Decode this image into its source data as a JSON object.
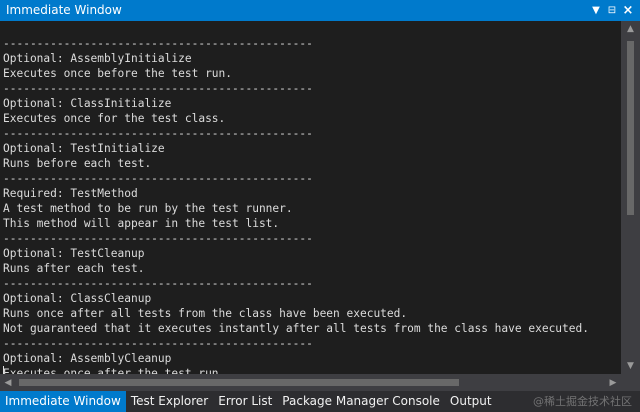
{
  "window": {
    "title": "Immediate Window",
    "dropdown_glyph": "▼",
    "pin_glyph": "⊟",
    "close_glyph": "×"
  },
  "editor": {
    "lines": [
      "----------------------------------------------",
      "Optional: AssemblyInitialize",
      "Executes once before the test run.",
      "----------------------------------------------",
      "Optional: ClassInitialize",
      "Executes once for the test class.",
      "----------------------------------------------",
      "Optional: TestInitialize",
      "Runs before each test.",
      "----------------------------------------------",
      "Required: TestMethod",
      "A test method to be run by the test runner.",
      "This method will appear in the test list.",
      "----------------------------------------------",
      "Optional: TestCleanup",
      "Runs after each test.",
      "----------------------------------------------",
      "Optional: ClassCleanup",
      "Runs once after all tests from the class have been executed.",
      "Not guaranteed that it executes instantly after all tests from the class have executed.",
      "----------------------------------------------",
      "Optional: AssemblyCleanup",
      "Executes once after the test run."
    ]
  },
  "scrollbars": {
    "up_glyph": "▲",
    "down_glyph": "▼",
    "left_glyph": "◀",
    "right_glyph": "▶"
  },
  "bottom_tabs": [
    "Immediate Window",
    "Test Explorer",
    "Error List",
    "Package Manager Console",
    "Output"
  ],
  "watermark": "@稀土掘金技术社区",
  "colors": {
    "accent": "#007acc",
    "editor_bg": "#1e1e1e",
    "chrome_bg": "#2d2d30",
    "text": "#dcdcdc"
  }
}
